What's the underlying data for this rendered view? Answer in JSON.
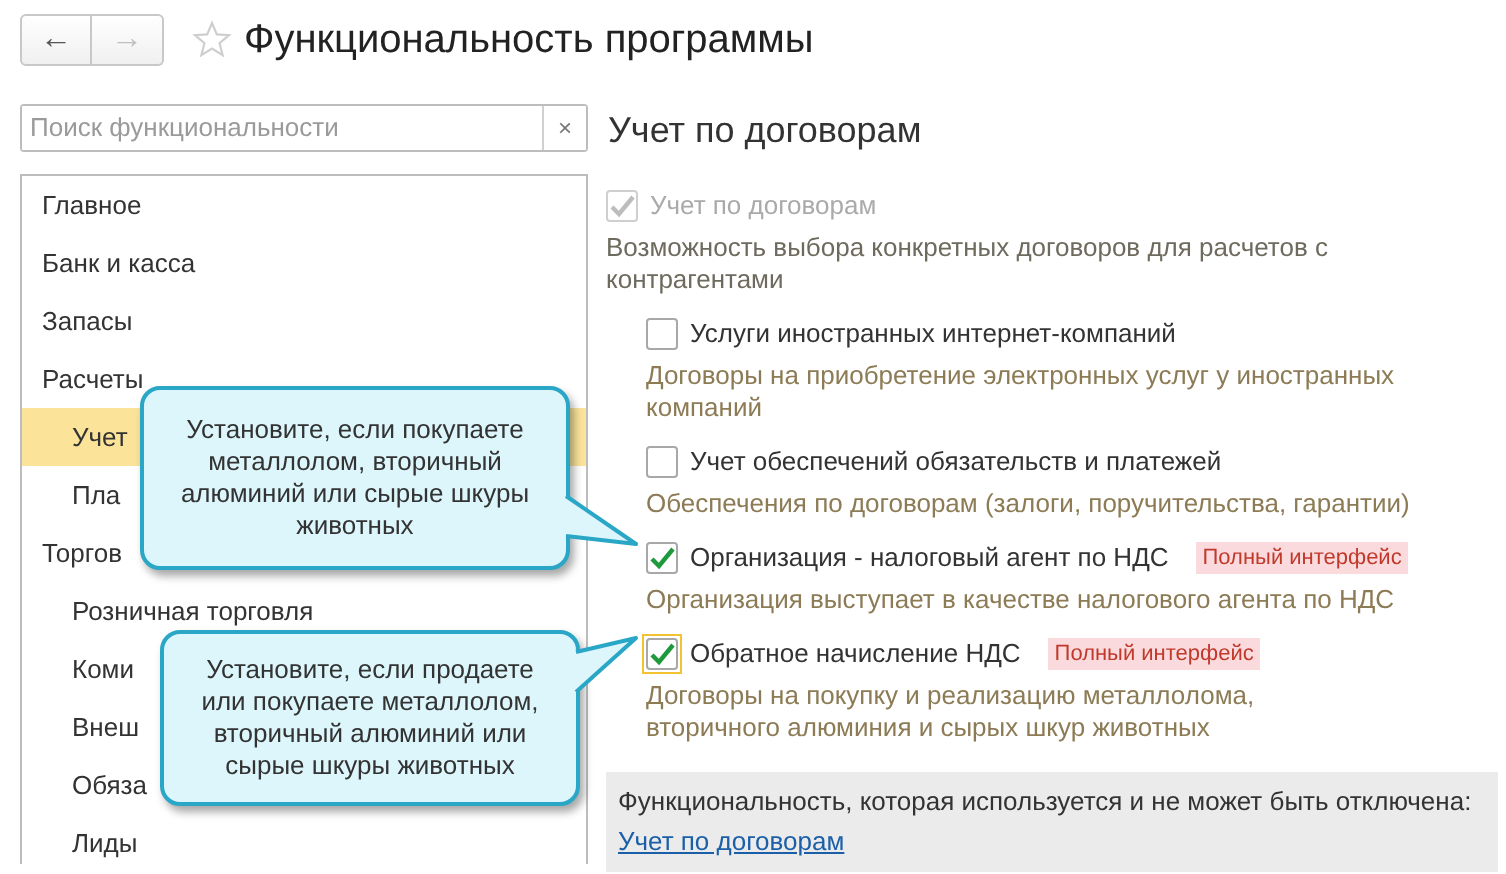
{
  "toolbar": {
    "back": {
      "label": "←",
      "disabled": false
    },
    "forward": {
      "label": "→",
      "disabled": true
    },
    "favorite": false,
    "title": "Функциональность программы"
  },
  "search": {
    "placeholder": "Поиск функциональности",
    "clear": "×"
  },
  "sidebar": {
    "items": [
      {
        "label": "Главное",
        "selected": false
      },
      {
        "label": "Банк и касса",
        "selected": false
      },
      {
        "label": "Запасы",
        "selected": false
      },
      {
        "label": "Расчеты",
        "selected": false,
        "children": [
          {
            "label": "Учет",
            "selected": true
          },
          {
            "label": "Пла",
            "selected": false
          }
        ]
      },
      {
        "label": "Торгов",
        "selected": false,
        "children": [
          {
            "label": "Розничная торговля",
            "selected": false
          },
          {
            "label": "Коми",
            "selected": false
          },
          {
            "label": "Внеш",
            "selected": false
          },
          {
            "label": "Обяза",
            "selected": false
          },
          {
            "label": "Лиды",
            "selected": false
          }
        ]
      }
    ]
  },
  "section": {
    "title": "Учет по договорам",
    "main_option": {
      "label": "Учет по договорам",
      "checked": true,
      "disabled": true,
      "description": "Возможность выбора конкретных договоров для расчетов с контрагентами"
    },
    "options": [
      {
        "label": "Услуги иностранных интернет-компаний",
        "checked": false,
        "description": "Договоры на приобретение электронных услуг у иностранных компаний"
      },
      {
        "label": "Учет обеспечений обязательств и платежей",
        "checked": false,
        "description": "Обеспечения по договорам (залоги, поручительства, гарантии)"
      },
      {
        "label": "Организация - налоговый агент по НДС",
        "checked": true,
        "badge": "Полный интерфейс",
        "description": "Организация выступает в качестве налогового агента по НДС"
      },
      {
        "label": "Обратное начисление НДС",
        "checked": true,
        "focused": true,
        "badge": "Полный интерфейс",
        "description": "Договоры на покупку и реализацию металлолома,\nвторичного алюминия и сырых шкур животных"
      }
    ],
    "used_box": {
      "text": "Функциональность, которая используется и не может быть отключена:",
      "link": "Учет по договорам"
    }
  },
  "callouts": [
    {
      "text": "Установите, если покупаете металлолом, вторичный алюминий или сырые шкуры животных"
    },
    {
      "text": "Установите, если продаете или покупаете металлолом, вторичный алюминий или сырые шкуры животных"
    }
  ]
}
